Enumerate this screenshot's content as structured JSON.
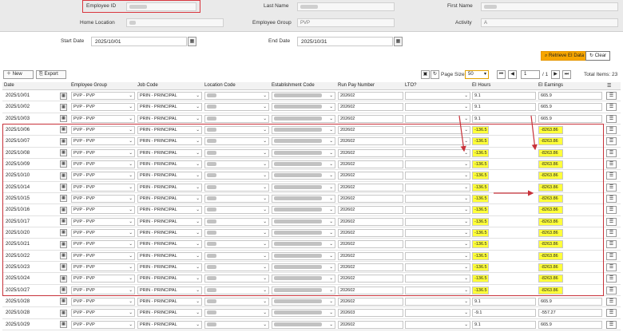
{
  "header": {
    "employee_id_label": "Employee ID",
    "last_name_label": "Last Name",
    "first_name_label": "First Name",
    "home_location_label": "Home Location",
    "employee_group_label": "Employee Group",
    "employee_group_value": "PVP",
    "activity_label": "Activity",
    "activity_value": "A"
  },
  "filters": {
    "start_date_label": "Start Date",
    "start_date_value": "2025/10/01",
    "end_date_label": "End Date",
    "end_date_value": "2025/10/31",
    "retrieve_label": "Retrieve EI Data",
    "clear_label": "Clear"
  },
  "toolbar": {
    "new_label": "New",
    "export_label": "Export",
    "page_size_label": "Page Size:",
    "page_size_value": "50",
    "page_value": "1",
    "page_of": "/ 1",
    "total_items": "Total Items: 23"
  },
  "columns": {
    "date": "Date",
    "employee_group": "Employee Group",
    "job_code": "Job Code",
    "location_code": "Location Code",
    "establishment_code": "Establishment Code",
    "run_pay_number": "Run Pay Number",
    "lto": "LTO?",
    "ei_hours": "EI Hours",
    "ei_earnings": "EI Earnings"
  },
  "rows": [
    {
      "date": "2025/10/01",
      "group": "PVP - PVP",
      "job": "PRIN - PRINCIPAL",
      "run": "202602",
      "hours": "9.1",
      "earnings": "665.9",
      "flag": false
    },
    {
      "date": "2025/10/02",
      "group": "PVP - PVP",
      "job": "PRIN - PRINCIPAL",
      "run": "202602",
      "hours": "9.1",
      "earnings": "665.9",
      "flag": false
    },
    {
      "date": "2025/10/03",
      "group": "PVP - PVP",
      "job": "PRIN - PRINCIPAL",
      "run": "202602",
      "hours": "9.1",
      "earnings": "665.9",
      "flag": false
    },
    {
      "date": "2025/10/06",
      "group": "PVP - PVP",
      "job": "PRIN - PRINCIPAL",
      "run": "202602",
      "hours": "-136.5",
      "earnings": "-8263.86",
      "flag": true
    },
    {
      "date": "2025/10/07",
      "group": "PVP - PVP",
      "job": "PRIN - PRINCIPAL",
      "run": "202602",
      "hours": "-136.5",
      "earnings": "-8263.86",
      "flag": true
    },
    {
      "date": "2025/10/08",
      "group": "PVP - PVP",
      "job": "PRIN - PRINCIPAL",
      "run": "202602",
      "hours": "-136.5",
      "earnings": "-8263.86",
      "flag": true
    },
    {
      "date": "2025/10/09",
      "group": "PVP - PVP",
      "job": "PRIN - PRINCIPAL",
      "run": "202602",
      "hours": "-136.5",
      "earnings": "-8263.86",
      "flag": true
    },
    {
      "date": "2025/10/10",
      "group": "PVP - PVP",
      "job": "PRIN - PRINCIPAL",
      "run": "202602",
      "hours": "-136.5",
      "earnings": "-8263.86",
      "flag": true
    },
    {
      "date": "2025/10/14",
      "group": "PVP - PVP",
      "job": "PRIN - PRINCIPAL",
      "run": "202602",
      "hours": "-136.5",
      "earnings": "-8263.86",
      "flag": true
    },
    {
      "date": "2025/10/15",
      "group": "PVP - PVP",
      "job": "PRIN - PRINCIPAL",
      "run": "202602",
      "hours": "-136.5",
      "earnings": "-8263.86",
      "flag": true
    },
    {
      "date": "2025/10/16",
      "group": "PVP - PVP",
      "job": "PRIN - PRINCIPAL",
      "run": "202602",
      "hours": "-136.5",
      "earnings": "-8263.86",
      "flag": true
    },
    {
      "date": "2025/10/17",
      "group": "PVP - PVP",
      "job": "PRIN - PRINCIPAL",
      "run": "202602",
      "hours": "-136.5",
      "earnings": "-8263.86",
      "flag": true
    },
    {
      "date": "2025/10/20",
      "group": "PVP - PVP",
      "job": "PRIN - PRINCIPAL",
      "run": "202602",
      "hours": "-136.5",
      "earnings": "-8263.86",
      "flag": true
    },
    {
      "date": "2025/10/21",
      "group": "PVP - PVP",
      "job": "PRIN - PRINCIPAL",
      "run": "202602",
      "hours": "-136.5",
      "earnings": "-8263.86",
      "flag": true
    },
    {
      "date": "2025/10/22",
      "group": "PVP - PVP",
      "job": "PRIN - PRINCIPAL",
      "run": "202602",
      "hours": "-136.5",
      "earnings": "-8263.86",
      "flag": true
    },
    {
      "date": "2025/10/23",
      "group": "PVP - PVP",
      "job": "PRIN - PRINCIPAL",
      "run": "202602",
      "hours": "-136.5",
      "earnings": "-8263.86",
      "flag": true
    },
    {
      "date": "2025/10/24",
      "group": "PVP - PVP",
      "job": "PRIN - PRINCIPAL",
      "run": "202602",
      "hours": "-136.5",
      "earnings": "-8263.86",
      "flag": true
    },
    {
      "date": "2025/10/27",
      "group": "PVP - PVP",
      "job": "PRIN - PRINCIPAL",
      "run": "202602",
      "hours": "-136.5",
      "earnings": "-8263.86",
      "flag": true
    },
    {
      "date": "2025/10/28",
      "group": "PVP - PVP",
      "job": "PRIN - PRINCIPAL",
      "run": "202602",
      "hours": "9.1",
      "earnings": "665.9",
      "flag": false
    },
    {
      "date": "2025/10/28",
      "group": "PVP - PVP",
      "job": "PRIN - PRINCIPAL",
      "run": "202603",
      "hours": "-9.1",
      "earnings": "-557.27",
      "flag": false
    },
    {
      "date": "2025/10/29",
      "group": "PVP - PVP",
      "job": "PRIN - PRINCIPAL",
      "run": "202602",
      "hours": "9.1",
      "earnings": "665.9",
      "flag": false
    }
  ],
  "colors": {
    "highlight": "#ffff3a",
    "annotation_red": "#c8323a",
    "retrieve_orange": "#f7a600"
  }
}
